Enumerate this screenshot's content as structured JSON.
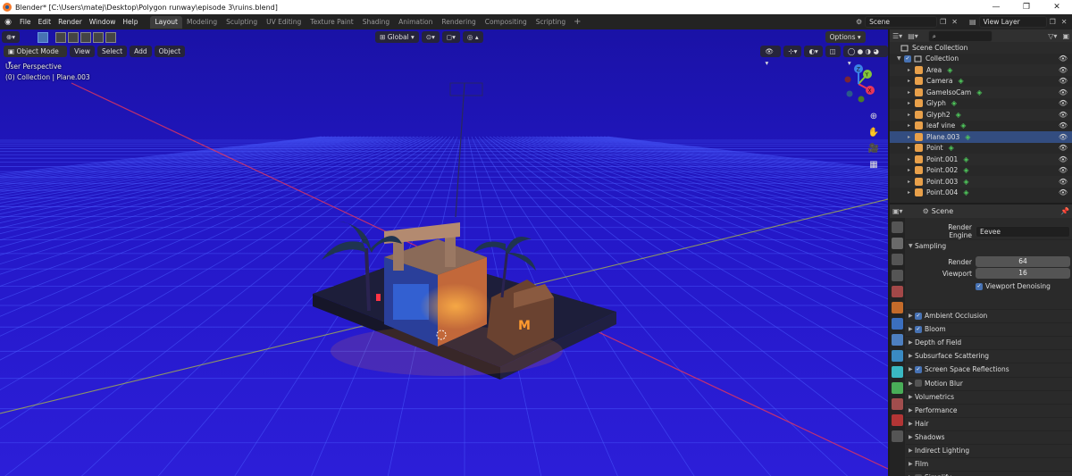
{
  "window": {
    "title": "Blender* [C:\\Users\\matej\\Desktop\\Polygon runway\\episode 3\\ruins.blend]",
    "minimize": "—",
    "maximize": "❐",
    "close": "✕"
  },
  "menu": [
    "File",
    "Edit",
    "Render",
    "Window",
    "Help"
  ],
  "workspaces": [
    "Layout",
    "Modeling",
    "Sculpting",
    "UV Editing",
    "Texture Paint",
    "Shading",
    "Animation",
    "Rendering",
    "Compositing",
    "Scripting"
  ],
  "active_workspace": "Layout",
  "scene_name": "Scene",
  "view_layer": "View Layer",
  "viewport": {
    "mode": "Object Mode",
    "menus": [
      "View",
      "Select",
      "Add",
      "Object"
    ],
    "transform_orientation": "Global",
    "options_label": "Options",
    "perspective_label": "User Perspective",
    "context_label": "(0) Collection | Plane.003",
    "gizmo_axes": [
      "X",
      "Y",
      "Z"
    ]
  },
  "outliner": {
    "root": "Scene Collection",
    "collection": "Collection",
    "items": [
      {
        "name": "Area",
        "icon": "light-icon",
        "extra": "light-data-icon"
      },
      {
        "name": "Camera",
        "icon": "camera-icon",
        "extra": "camera-data-icon"
      },
      {
        "name": "GameIsoCam",
        "icon": "camera-icon",
        "extra": "camera-data-icon"
      },
      {
        "name": "Glyph",
        "icon": "mesh-icon",
        "extra": "modifier-icon"
      },
      {
        "name": "Glyph2",
        "icon": "mesh-icon",
        "extra": "modifier-icon"
      },
      {
        "name": "leaf vine",
        "icon": "mesh-icon",
        "extra": "mesh-data-icon"
      },
      {
        "name": "Plane.003",
        "icon": "mesh-icon",
        "extra": "mesh-data-icon"
      },
      {
        "name": "Point",
        "icon": "light-icon",
        "extra": "light-data-icon"
      },
      {
        "name": "Point.001",
        "icon": "light-icon",
        "extra": "light-data-icon"
      },
      {
        "name": "Point.002",
        "icon": "light-icon",
        "extra": "light-data-icon"
      },
      {
        "name": "Point.003",
        "icon": "light-icon",
        "extra": "light-data-icon"
      },
      {
        "name": "Point.004",
        "icon": "light-icon",
        "extra": "light-data-icon"
      }
    ]
  },
  "properties": {
    "context": "Scene",
    "render_engine_label": "Render Engine",
    "render_engine": "Eevee",
    "sampling_label": "Sampling",
    "render_label": "Render",
    "render_samples": "64",
    "viewport_label": "Viewport",
    "viewport_samples": "16",
    "viewport_denoising": "Viewport Denoising",
    "panels": [
      {
        "label": "Ambient Occlusion",
        "checkbox": true
      },
      {
        "label": "Bloom",
        "checkbox": true
      },
      {
        "label": "Depth of Field"
      },
      {
        "label": "Subsurface Scattering"
      },
      {
        "label": "Screen Space Reflections",
        "checkbox": true
      },
      {
        "label": "Motion Blur",
        "checkbox": false
      },
      {
        "label": "Volumetrics"
      },
      {
        "label": "Performance"
      },
      {
        "label": "Hair"
      },
      {
        "label": "Shadows"
      },
      {
        "label": "Indirect Lighting"
      },
      {
        "label": "Film"
      },
      {
        "label": "Simplify",
        "checkbox": false
      }
    ]
  },
  "colors": {
    "viewport_bg": "#1a12b0",
    "grid": "#3b4ff0",
    "accent": "#4772b3",
    "x_axis": "#e8365a",
    "y_axis": "#84c63a",
    "z_axis": "#3b82e8"
  }
}
